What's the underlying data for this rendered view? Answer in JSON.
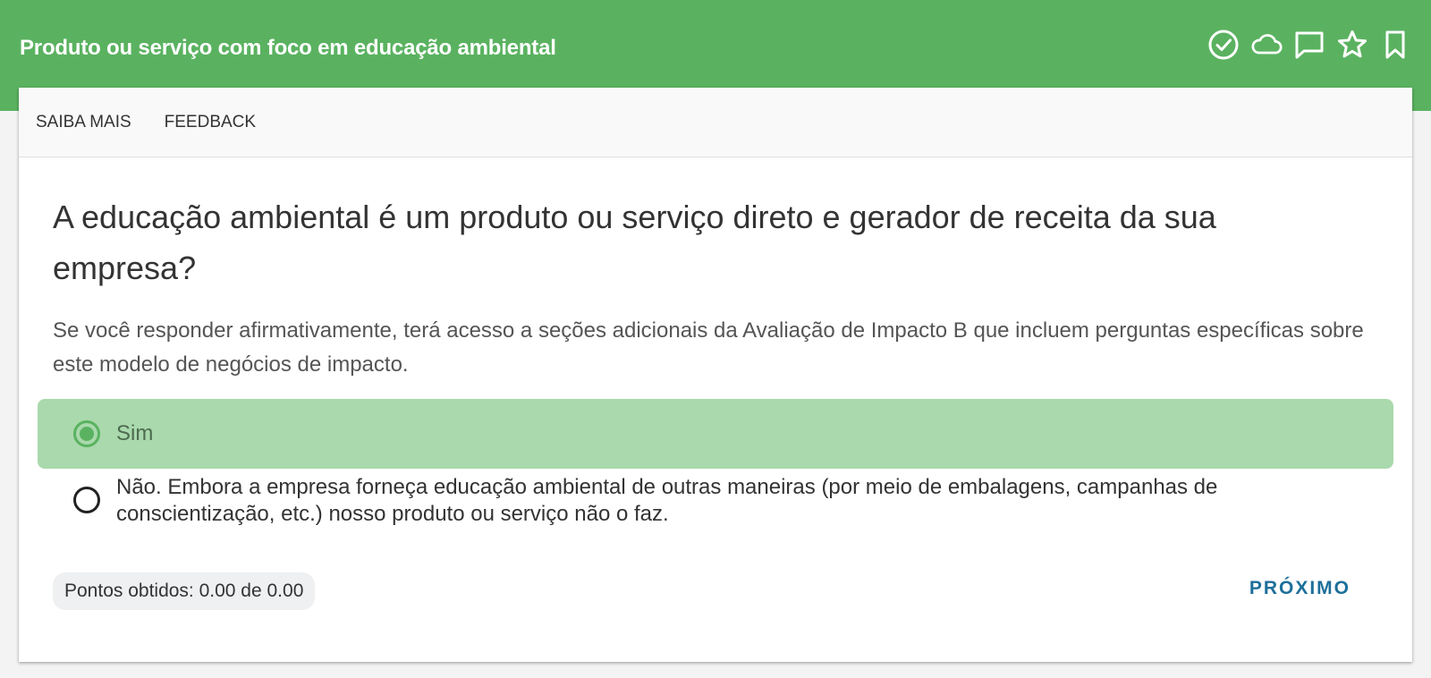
{
  "header": {
    "title": "Produto ou serviço com foco em educação ambiental",
    "icons": [
      "check-circle-icon",
      "cloud-icon",
      "comment-icon",
      "star-icon",
      "bookmark-icon"
    ],
    "background_color": "#5ab260"
  },
  "tabs": [
    {
      "label": "SAIBA MAIS"
    },
    {
      "label": "FEEDBACK"
    }
  ],
  "question": {
    "title": "A educação ambiental é um produto ou serviço direto e gerador de receita da sua empresa?",
    "description": "Se você responder afirmativamente, terá acesso a seções adicionais da Avaliação de Impacto B que incluem perguntas específicas sobre este modelo de negócios de impacto."
  },
  "options": [
    {
      "label": "Sim",
      "selected": true
    },
    {
      "label": "Não. Embora a empresa forneça educação ambiental de outras maneiras (por meio de embalagens, campanhas de conscientização, etc.) nosso produto ou serviço não o faz.",
      "selected": false
    }
  ],
  "footer": {
    "score": "Pontos obtidos: 0.00 de 0.00",
    "next_label": "PRÓXIMO"
  },
  "colors": {
    "accent": "#5ab260",
    "selected_option": "#a9d9ac",
    "link": "#1d6f9a"
  }
}
